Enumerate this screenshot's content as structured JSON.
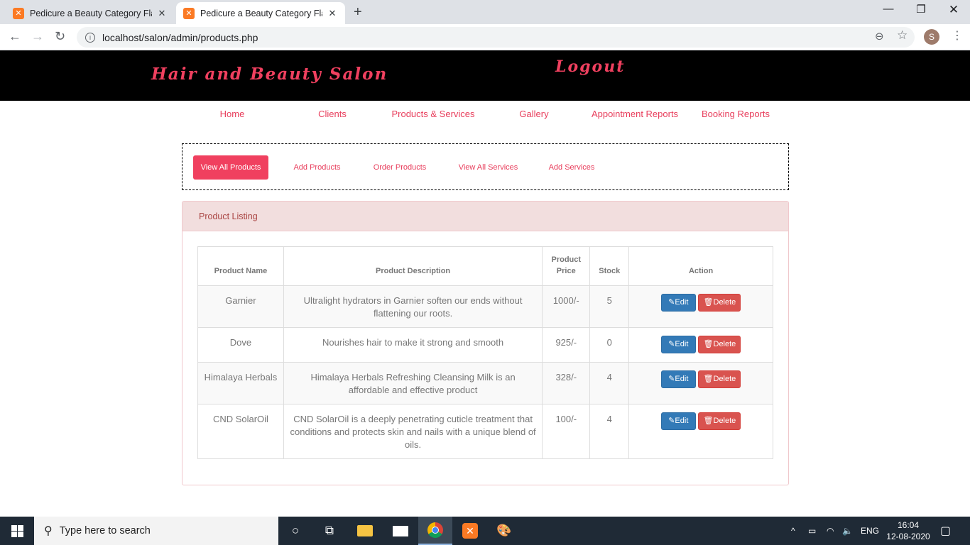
{
  "browser": {
    "tabs": [
      {
        "title": "Pedicure a Beauty Category Flat B",
        "favicon": "xampp-icon"
      },
      {
        "title": "Pedicure a Beauty Category Flat B",
        "favicon": "xampp-icon"
      }
    ],
    "url": "localhost/salon/admin/products.php",
    "profile_initial": "S"
  },
  "header": {
    "brand": "Hair and Beauty Salon",
    "logout": "Logout",
    "brand_color": "#f0405f",
    "background": "#000000"
  },
  "mainnav": {
    "items": [
      "Home",
      "Clients",
      "Products & Services",
      "Gallery",
      "Appointment Reports",
      "Booking Reports"
    ]
  },
  "subnav": {
    "items": [
      "View All Products",
      "Add Products",
      "Order Products",
      "View All Services",
      "Add Services"
    ],
    "active": "View All Products"
  },
  "panel": {
    "heading": "Product Listing",
    "columns": [
      "Product Name",
      "Product Description",
      "Product Price",
      "Stock",
      "Action"
    ],
    "rows": [
      {
        "name": "Garnier",
        "description": "Ultralight hydrators in Garnier soften our ends without flattening our roots.",
        "price": "1000/-",
        "stock": "5"
      },
      {
        "name": "Dove",
        "description": "Nourishes hair to make it strong and smooth",
        "price": "925/-",
        "stock": "0"
      },
      {
        "name": "Himalaya Herbals",
        "description": "Himalaya Herbals Refreshing Cleansing Milk is an affordable and effective product",
        "price": "328/-",
        "stock": "4"
      },
      {
        "name": "CND SolarOil",
        "description": "CND SolarOil is a deeply penetrating cuticle treatment that conditions and protects skin and nails with a unique blend of oils.",
        "price": "100/-",
        "stock": "4"
      }
    ],
    "edit_label": "Edit",
    "delete_label": "Delete"
  },
  "taskbar": {
    "search_placeholder": "Type here to search",
    "language": "ENG",
    "time": "16:04",
    "date": "12-08-2020"
  }
}
